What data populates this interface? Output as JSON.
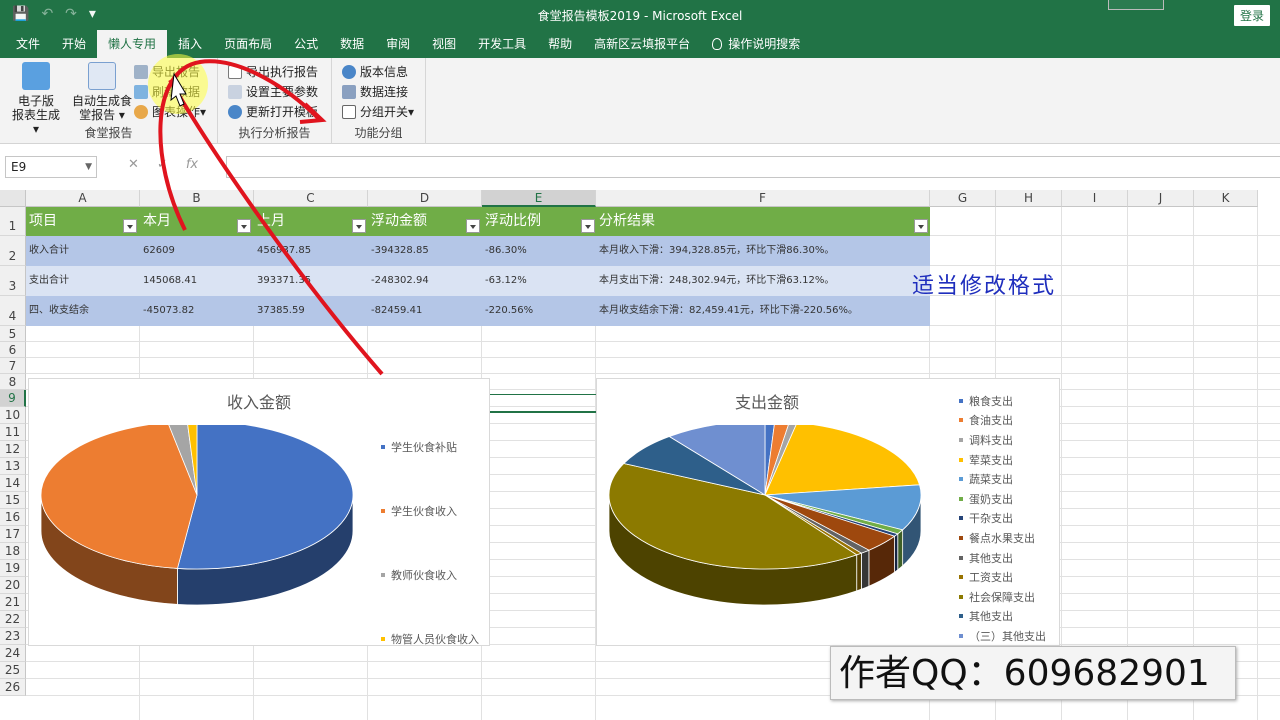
{
  "title_bar": {
    "title": "食堂报告模板2019  -  Microsoft Excel",
    "login": "登录"
  },
  "tabs": [
    "文件",
    "开始",
    "懒人专用",
    "插入",
    "页面布局",
    "公式",
    "数据",
    "审阅",
    "视图",
    "开发工具",
    "帮助",
    "高新区云填报平台",
    "操作说明搜索"
  ],
  "ribbon": {
    "group1": {
      "label": "食堂报告",
      "btn1": "电子版\n报表生成",
      "btn2": "自动生成食\n堂报告",
      "small": [
        "导出报告",
        "刷新数据",
        "图表操作"
      ]
    },
    "group2": {
      "label": "执行分析报告",
      "small": [
        "导出执行报告",
        "设置主要参数",
        "更新打开模板"
      ]
    },
    "group3": {
      "label": "功能分组",
      "small": [
        "版本信息",
        "数据连接",
        "分组开关"
      ]
    }
  },
  "formula_bar": {
    "cell": "E9",
    "value": ""
  },
  "columns": [
    "A",
    "B",
    "C",
    "D",
    "E",
    "F",
    "G",
    "H",
    "I",
    "J",
    "K"
  ],
  "rows": [
    "1",
    "2",
    "3",
    "4",
    "5",
    "6",
    "7",
    "8",
    "9",
    "10",
    "11",
    "12",
    "13",
    "14",
    "15",
    "16",
    "17",
    "18",
    "19",
    "20",
    "21",
    "22",
    "23",
    "24",
    "25",
    "26"
  ],
  "table": {
    "headers": [
      "项目",
      "本月",
      "上月",
      "浮动金额",
      "浮动比例",
      "分析结果"
    ],
    "rows": [
      [
        "收入合计",
        "62609",
        "456937.85",
        "-394328.85",
        "-86.30%",
        "本月收入下滑：394,328.85元，环比下滑86.30%。"
      ],
      [
        "支出合计",
        "145068.41",
        "393371.35",
        "-248302.94",
        "-63.12%",
        "本月支出下滑：248,302.94元，环比下滑63.12%。"
      ],
      [
        "四、收支结余",
        "-45073.82",
        "37385.59",
        "-82459.41",
        "-220.56%",
        "本月收支结余下滑：82,459.41元，环比下滑-220.56%。"
      ]
    ]
  },
  "note": "适当修改格式",
  "watermark": "作者QQ：609682901",
  "chart_data": [
    {
      "type": "pie",
      "title": "收入金额",
      "categories": [
        "学生伙食补贴",
        "学生伙食收入",
        "教师伙食收入",
        "物管人员伙食收入"
      ],
      "values": [
        52,
        45,
        2,
        1
      ],
      "colors": [
        "#4472c4",
        "#ed7d31",
        "#a5a5a5",
        "#ffc000"
      ]
    },
    {
      "type": "pie",
      "title": "支出金额",
      "categories": [
        "粮食支出",
        "食油支出",
        "调料支出",
        "荤菜支出",
        "蔬菜支出",
        "蛋奶支出",
        "干杂支出",
        "餐点水果支出",
        "其他支出",
        "工资支出",
        "社会保障支出",
        "其他支出",
        "（三）其他支出"
      ],
      "values": [
        1,
        1.5,
        0.8,
        19.5,
        10,
        1,
        0.6,
        4,
        1,
        0.6,
        42,
        7.5,
        10.5
      ],
      "colors": [
        "#4472c4",
        "#ed7d31",
        "#a5a5a5",
        "#ffc000",
        "#5b9bd5",
        "#70ad47",
        "#264478",
        "#9e480e",
        "#636363",
        "#997300",
        "#8c7a00",
        "#2e5f8a",
        "#6f8fd0"
      ]
    }
  ]
}
